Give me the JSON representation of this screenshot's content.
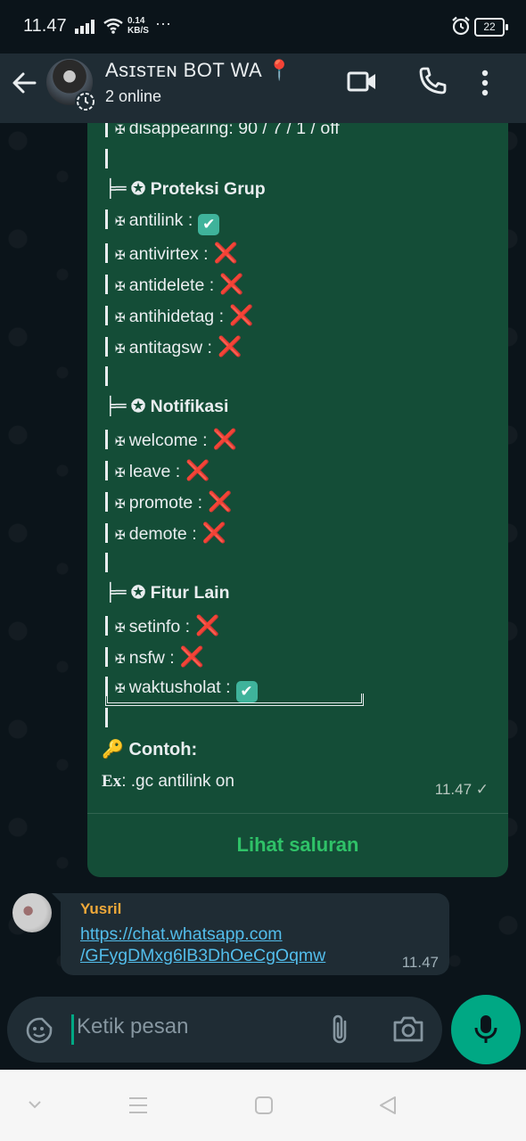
{
  "status_bar": {
    "time": "11.47",
    "net_speed_value": "0.14",
    "net_speed_unit": "KB/S",
    "more": "···",
    "battery": "22"
  },
  "header": {
    "title": "Asɪsᴛᴇɴ BOT WA",
    "title_pin": "📍",
    "subtitle": "2 online"
  },
  "message": {
    "sections": [
      {
        "type": "item",
        "text": "disappearing: 90 / 7 / 1 / off"
      },
      {
        "type": "spacer"
      },
      {
        "type": "section",
        "text": "Proteksi Grup"
      },
      {
        "type": "item",
        "text": "antilink :",
        "status": "on"
      },
      {
        "type": "item",
        "text": "antivirtex :",
        "status": "off"
      },
      {
        "type": "item",
        "text": "antidelete :",
        "status": "off"
      },
      {
        "type": "item",
        "text": "antihidetag :",
        "status": "off"
      },
      {
        "type": "item",
        "text": "antitagsw :",
        "status": "off"
      },
      {
        "type": "spacer"
      },
      {
        "type": "section",
        "text": "Notifikasi"
      },
      {
        "type": "item",
        "text": "welcome :",
        "status": "off"
      },
      {
        "type": "item",
        "text": "leave :",
        "status": "off"
      },
      {
        "type": "item",
        "text": "promote :",
        "status": "off"
      },
      {
        "type": "item",
        "text": "demote :",
        "status": "off"
      },
      {
        "type": "spacer"
      },
      {
        "type": "section",
        "text": "Fitur Lain"
      },
      {
        "type": "item",
        "text": "setinfo :",
        "status": "off"
      },
      {
        "type": "item",
        "text": "nsfw :",
        "status": "off"
      },
      {
        "type": "item",
        "text": "waktusholat :",
        "status": "on"
      },
      {
        "type": "spacer"
      }
    ],
    "item_prefix": "✠",
    "section_tee": "╞═",
    "section_bullet": "✪",
    "status_on_glyph": "✔",
    "status_off_glyph": "❌",
    "example_icon": "🔑",
    "example_label": "Contoh:",
    "example_prefix": "Ex",
    "example_text": ": .gc antilink on",
    "time": "11.47 ✓",
    "view_channel": "Lihat saluran"
  },
  "received": {
    "sender": "Yusril",
    "link_line1": "https://chat.whatsapp.com",
    "link_line2": "/GFygDMxg6lB3DhOeCgOqmw",
    "time": "11.47"
  },
  "composer": {
    "placeholder": "Ketik pesan"
  },
  "colors": {
    "bubble": "#144d37",
    "header": "#1f2c34",
    "accent": "#00a884",
    "link": "#53bdeb",
    "sender": "#f0a93a"
  }
}
